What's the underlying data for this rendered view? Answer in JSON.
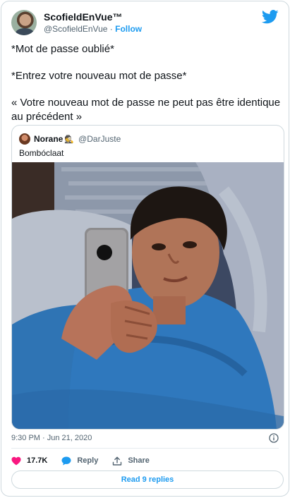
{
  "tweet": {
    "author": {
      "display_name": "ScofieldEnVue™",
      "handle": "@ScofieldEnVue",
      "separator": " · ",
      "follow_label": "Follow"
    },
    "paragraphs": [
      "*Mot de passe oublié*",
      "*Entrez votre nouveau mot de passe*",
      "« Votre nouveau mot de passe ne peut pas être identique au précédent »"
    ],
    "quoted": {
      "display_name": "Norane",
      "emoji": "🕵",
      "handle": "@DarJuste",
      "text": "Bombóclaat"
    },
    "timestamp": "9:30 PM · Jun 21, 2020",
    "actions": {
      "likes": "17.7K",
      "reply_label": "Reply",
      "share_label": "Share"
    },
    "read_replies_label": "Read 9 replies"
  },
  "colors": {
    "accent": "#1d9bf0",
    "like": "#f91880",
    "muted": "#536471"
  },
  "icons": [
    "twitter-bird-icon",
    "info-icon",
    "heart-icon",
    "reply-bubble-icon",
    "share-icon"
  ]
}
